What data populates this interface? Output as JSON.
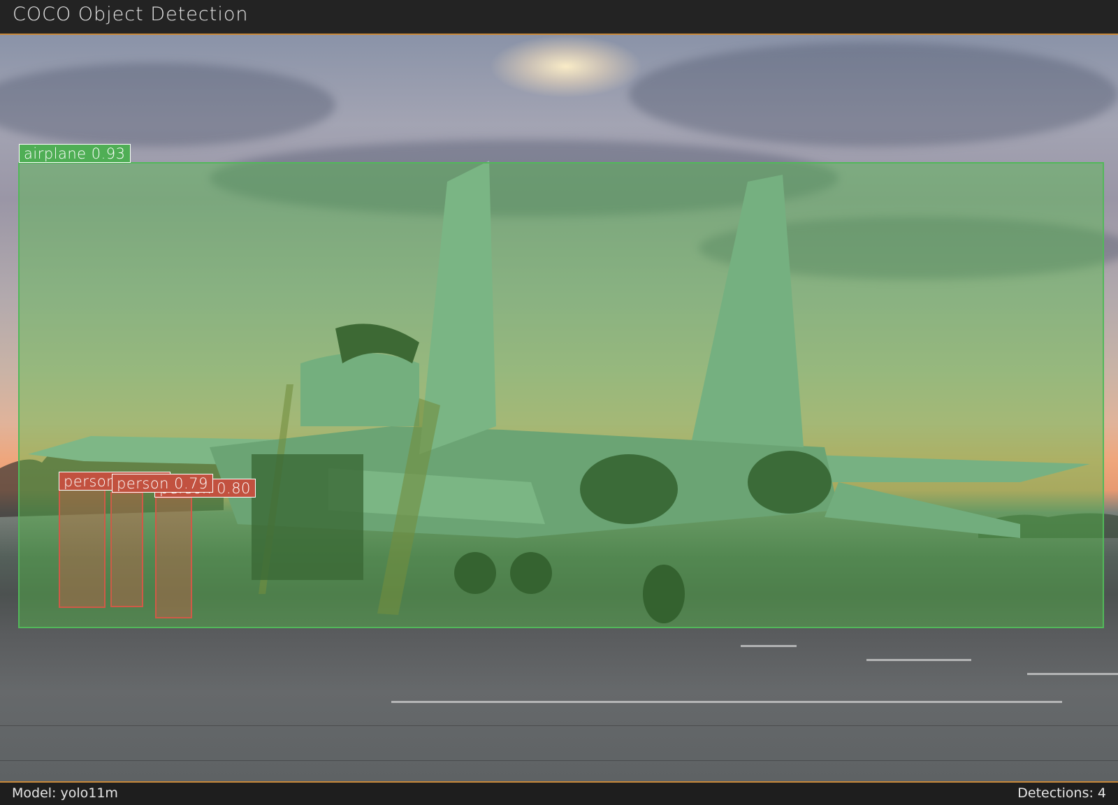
{
  "header": {
    "title": "COCO Object Detection"
  },
  "footer": {
    "model_text": "Model: yolo11m",
    "detections_text": "Detections: 4"
  },
  "colors": {
    "airplane": "#4fae55",
    "person": "#c2513f",
    "accent": "#c8893a"
  },
  "detections": [
    {
      "label": "airplane",
      "confidence": "0.93",
      "text": "airplane 0.93"
    },
    {
      "label": "person",
      "confidence": "0.80",
      "text": "person 0.80"
    },
    {
      "label": "person",
      "confidence": "0.79",
      "text": "person 0.79"
    },
    {
      "label": "person",
      "confidence": "",
      "text": "person"
    }
  ]
}
